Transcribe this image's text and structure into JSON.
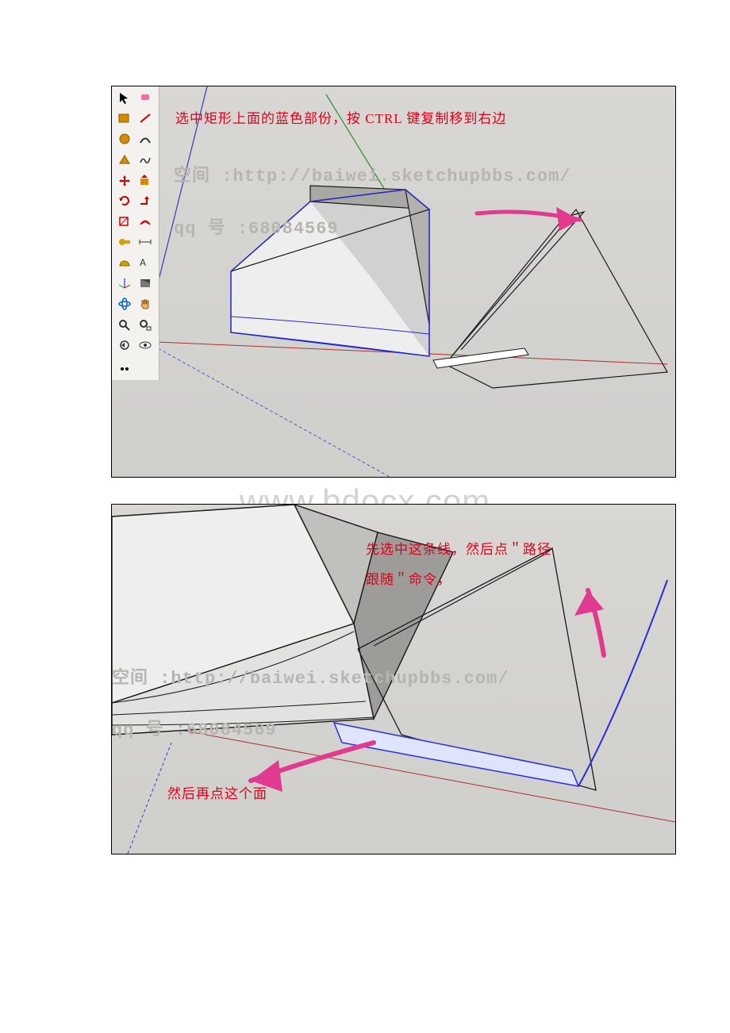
{
  "fig1": {
    "annot1": "选中矩形上面的蓝色部份，按 CTRL 键复制移到右边",
    "space_label": "空间",
    "url": ":http://baiwei.sketchupbbs.com/",
    "qq_label": "qq 号",
    "qq_num": ":68084569"
  },
  "fig2": {
    "annot1_line1": "先选中这条线，然后点＂路径",
    "annot1_line2": "跟随＂命令，",
    "annot2": "然后再点这个面",
    "space_label": "空间",
    "url": ":http://baiwei.sketchupbbs.com/",
    "qq_label": "qq 号",
    "qq_num": ":68084569"
  },
  "watermark": "www.bdocx.com",
  "toolbar": {
    "tools": [
      "select-icon",
      "eraser-icon",
      "rectangle-icon",
      "line-icon",
      "circle-icon",
      "arc-icon",
      "polygon-icon",
      "freehand-icon",
      "move-icon",
      "pushpull-icon",
      "rotate-icon",
      "followme-icon",
      "scale-icon",
      "offset-icon",
      "tape-icon",
      "dimension-icon",
      "protractor-icon",
      "text-icon",
      "axes-icon",
      "section-icon",
      "orbit-icon",
      "pan-icon",
      "zoom-icon",
      "zoom-extents-icon",
      "prev-icon",
      "next-icon",
      "position-icon",
      "lookaround-icon",
      "walk-icon",
      "shadows-icon"
    ]
  }
}
